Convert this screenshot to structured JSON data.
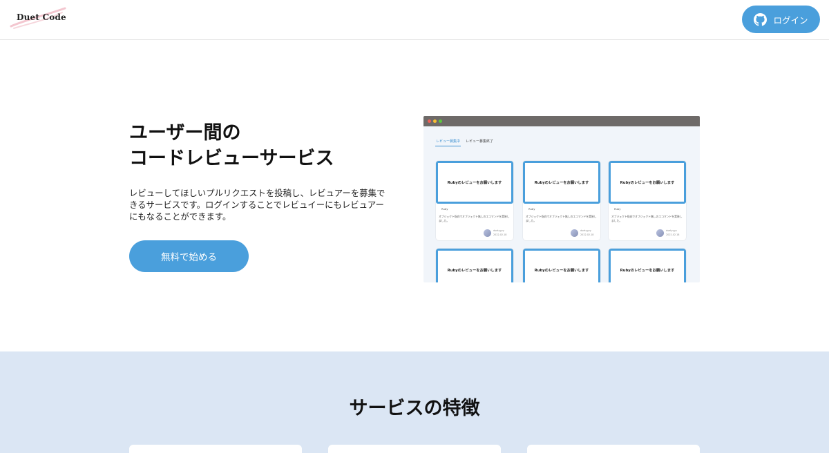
{
  "header": {
    "logo_text": "Duet Code",
    "login_label": "ログイン"
  },
  "hero": {
    "title_line1": "ユーザー間の",
    "title_line2": "コードレビューサービス",
    "description": "レビューしてほしいプルリクエストを投稿し、レビュアーを募集できるサービスです。ログインすることでレビュイーにもレビュアーにもなることができます。",
    "cta_label": "無料で始める"
  },
  "mock": {
    "tabs": [
      "レビュー募集中",
      "レビュー募集終了"
    ],
    "cards": [
      {
        "title": "Rubyのレビューをお願いします",
        "tag": "Ruby",
        "desc": "オブジェクト指向でオブジェクト無しのエコマンドを実装しました。",
        "user": "duetyyyy",
        "date": "2022.02.18"
      },
      {
        "title": "Rubyのレビューをお願いします",
        "tag": "Ruby",
        "desc": "オブジェクト指向でオブジェクト無しのエコマンドを実装しました。",
        "user": "duetyyyy",
        "date": "2022.02.18"
      },
      {
        "title": "Rubyのレビューをお願いします",
        "tag": "Ruby",
        "desc": "オブジェクト指向でオブジェクト無しのエコマンドを実装しました。",
        "user": "duetyyyy",
        "date": "2022.02.18"
      },
      {
        "title": "Rubyのレビューをお願いします"
      },
      {
        "title": "Rubyのレビューをお願いします"
      },
      {
        "title": "Rubyのレビューをお願いします"
      }
    ],
    "window_dot_colors": [
      "#ee5f57",
      "#f7be31",
      "#5bc63d"
    ]
  },
  "features": {
    "title": "サービスの特徴"
  },
  "colors": {
    "accent": "#4a9fdc",
    "features_bg": "#dbe6f4"
  }
}
